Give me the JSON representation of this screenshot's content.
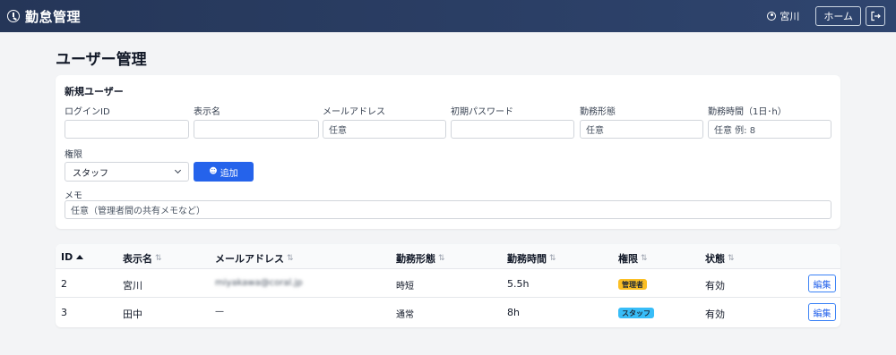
{
  "header": {
    "app_title": "勤怠管理",
    "user_name": "宮川",
    "home_label": "ホーム"
  },
  "page": {
    "title": "ユーザー管理"
  },
  "form": {
    "title": "新規ユーザー",
    "fields": {
      "login_id": {
        "label": "ログインID",
        "placeholder": ""
      },
      "display_name": {
        "label": "表示名",
        "placeholder": ""
      },
      "email": {
        "label": "メールアドレス",
        "placeholder": "任意"
      },
      "initial_password": {
        "label": "初期パスワード",
        "placeholder": ""
      },
      "employment_type": {
        "label": "勤務形態",
        "placeholder": "任意"
      },
      "work_hours": {
        "label": "勤務時間（1日･h）",
        "placeholder": "任意 例: 8"
      },
      "role": {
        "label": "権限",
        "value": "スタッフ"
      },
      "memo": {
        "label": "メモ",
        "placeholder": "任意（管理者間の共有メモなど）"
      }
    },
    "add_label": "追加"
  },
  "table": {
    "columns": [
      "ID",
      "表示名",
      "メールアドレス",
      "勤務形態",
      "勤務時間",
      "権限",
      "状態"
    ],
    "rows": [
      {
        "id": "2",
        "name": "宮川",
        "email": "miyakawa@coral.jp",
        "employment": "時短",
        "hours": "5.5",
        "hours_unit": "h",
        "role": "管理者",
        "status": "有効",
        "edit": "編集"
      },
      {
        "id": "3",
        "name": "田中",
        "email": "—",
        "employment": "通常",
        "hours": "8",
        "hours_unit": "h",
        "role": "スタッフ",
        "status": "有効",
        "edit": "編集"
      }
    ]
  },
  "colors": {
    "navbar": "#253658",
    "primary": "#2563eb",
    "badge_admin": "#fbbf24",
    "badge_staff": "#38bdf8"
  }
}
